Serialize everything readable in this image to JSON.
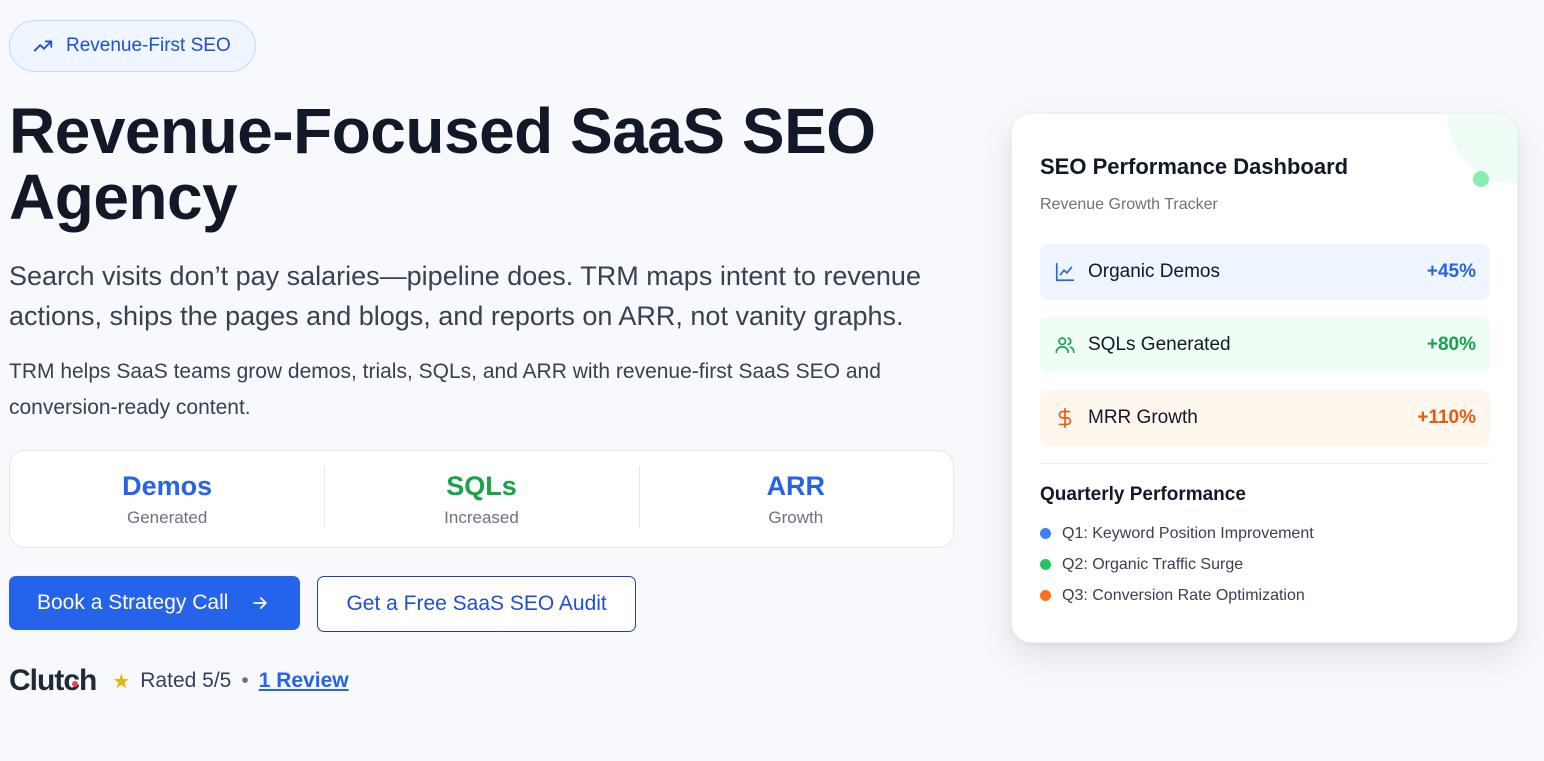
{
  "badge": {
    "label": "Revenue-First SEO",
    "icon": "trending-up-icon"
  },
  "hero": {
    "headline_line1": "Revenue-Focused SaaS SEO",
    "headline_line2": "Agency",
    "lead": "Search visits don’t pay salaries—pipeline does. TRM maps intent to revenue actions, ships the pages and blogs, and reports on ARR, not vanity graphs.",
    "sub": "TRM helps SaaS teams grow demos, trials, SQLs, and ARR with revenue-first SaaS SEO and conversion-ready content."
  },
  "stats": [
    {
      "value": "Demos",
      "label": "Generated",
      "color": "#2563eb"
    },
    {
      "value": "SQLs",
      "label": "Increased",
      "color": "#16a34a"
    },
    {
      "value": "ARR",
      "label": "Growth",
      "color": "#2563eb"
    }
  ],
  "cta": {
    "primary_label": "Book a Strategy Call",
    "primary_icon": "arrow-right-icon",
    "secondary_label": "Get a Free SaaS SEO Audit"
  },
  "rating": {
    "brand": "Clutch",
    "star_icon": "star-icon",
    "text": "Rated 5/5",
    "separator": "•",
    "review_link": "1 Review"
  },
  "dashboard": {
    "title": "SEO Performance Dashboard",
    "subtitle": "Revenue Growth Tracker",
    "status_color": "#86efac",
    "metrics": [
      {
        "icon": "line-chart-icon",
        "label": "Organic Demos",
        "value": "+45%",
        "color": "#2563eb"
      },
      {
        "icon": "users-icon",
        "label": "SQLs Generated",
        "value": "+80%",
        "color": "#16a34a"
      },
      {
        "icon": "dollar-icon",
        "label": "MRR Growth",
        "value": "+110%",
        "color": "#ea580c"
      }
    ],
    "quarterly_title": "Quarterly Performance",
    "quarters": [
      {
        "label": "Q1: Keyword Position Improvement",
        "color": "#3b82f6"
      },
      {
        "label": "Q2: Organic Traffic Surge",
        "color": "#22c55e"
      },
      {
        "label": "Q3: Conversion Rate Optimization",
        "color": "#f97316"
      }
    ]
  }
}
